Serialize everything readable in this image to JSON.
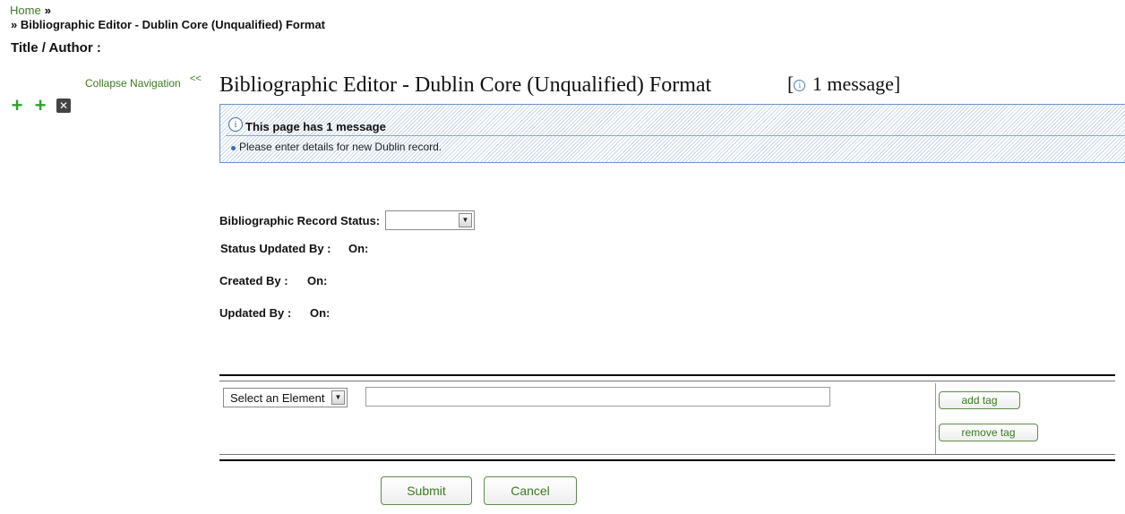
{
  "breadcrumb": {
    "home": "Home",
    "separator": "»",
    "current": "» Bibliographic Editor - Dublin Core (Unqualified) Format"
  },
  "title_author": "Title / Author :",
  "nav": {
    "collapse_label": "Collapse Navigation",
    "collapse_chevron": "<<",
    "icons": [
      "plus-icon",
      "plus-icon",
      "close-box-icon"
    ]
  },
  "header": {
    "title": "Bibliographic Editor - Dublin Core (Unqualified) Format",
    "message_open": "[",
    "message_info_icon": "i",
    "message_count": "1 message",
    "message_close": "]"
  },
  "messages": {
    "info_icon": "i",
    "heading": "This page has 1 message",
    "items": [
      "Please enter details for new Dublin record."
    ]
  },
  "record": {
    "status_label": "Bibliographic Record Status:",
    "status_value": "",
    "status_updated_by_label": "Status Updated By :",
    "status_on_label": "On:",
    "created_by_label": "Created By :",
    "created_on_label": "On:",
    "updated_by_label": "Updated By :",
    "updated_on_label": "On:"
  },
  "element_row": {
    "select_value": "Select an Element",
    "input_value": "",
    "add_tag_label": "add tag",
    "remove_tag_label": "remove tag"
  },
  "actions": {
    "submit_label": "Submit",
    "cancel_label": "Cancel"
  },
  "colors": {
    "link_green": "#3a7a1f",
    "button_border": "#5e8a4a",
    "info_blue": "#3d6aa8",
    "message_border": "#6c93c4"
  }
}
